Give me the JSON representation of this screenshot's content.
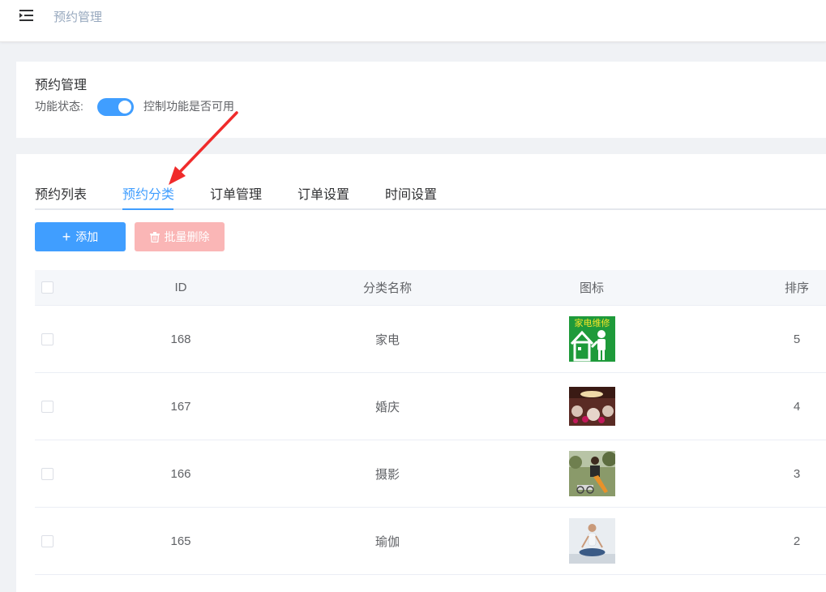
{
  "header": {
    "breadcrumb": "预约管理",
    "menu_icon": "menu-fold-icon"
  },
  "settings_card": {
    "title": "预约管理",
    "status_label": "功能状态:",
    "switch_on": true,
    "status_desc": "控制功能是否可用"
  },
  "tabs": [
    {
      "label": "预约列表",
      "active": false
    },
    {
      "label": "预约分类",
      "active": true
    },
    {
      "label": "订单管理",
      "active": false
    },
    {
      "label": "订单设置",
      "active": false
    },
    {
      "label": "时间设置",
      "active": false
    }
  ],
  "toolbar": {
    "add_label": "添加",
    "batch_delete_label": "批量删除"
  },
  "table": {
    "columns": [
      "ID",
      "分类名称",
      "图标",
      "排序"
    ],
    "rows": [
      {
        "id": "168",
        "name": "家电",
        "icon_text": "家电维修",
        "sort": "5"
      },
      {
        "id": "167",
        "name": "婚庆",
        "icon_text": "",
        "sort": "4"
      },
      {
        "id": "166",
        "name": "摄影",
        "icon_text": "",
        "sort": "3"
      },
      {
        "id": "165",
        "name": "瑜伽",
        "icon_text": "",
        "sort": "2"
      }
    ]
  },
  "colors": {
    "primary": "#409eff",
    "danger_disabled": "#fab6b6",
    "annotation_arrow": "#f02b2b"
  }
}
